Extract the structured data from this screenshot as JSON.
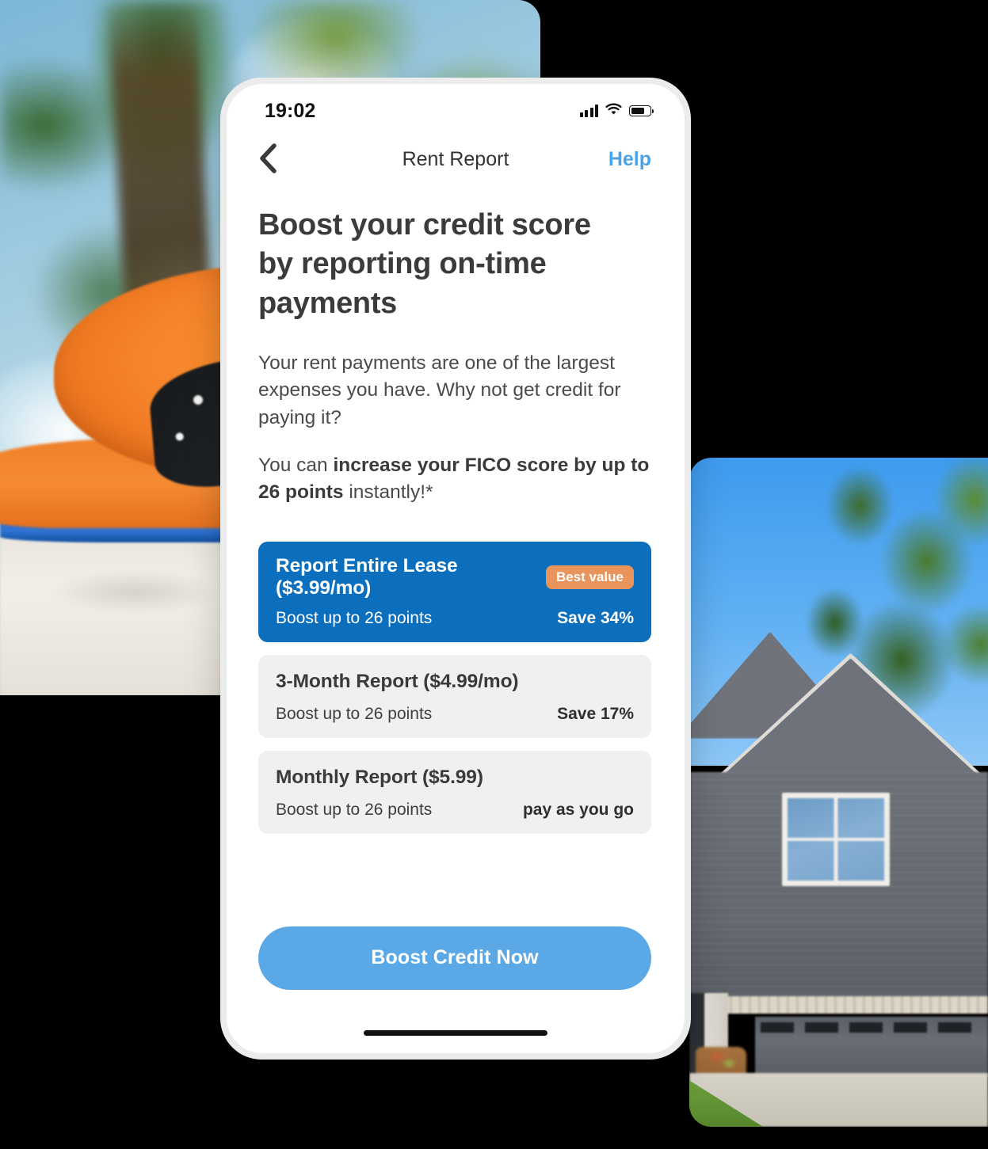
{
  "background": {
    "canvas_color": "#000000",
    "photo_beach": {
      "alt": "Blurred palm tree and sky above an orange sun hat with black polka-dot ribbon on white sand"
    },
    "photo_house": {
      "alt": "Gray two-story house with white-trim window, garage door, concrete driveway and green lawn under blue sky"
    }
  },
  "phone": {
    "status_bar": {
      "time": "19:02",
      "signal_icon": "cellular-signal-icon",
      "wifi_icon": "wifi-icon",
      "battery_icon": "battery-icon",
      "battery_level_percent": 72
    },
    "nav": {
      "back_icon": "chevron-left-icon",
      "title": "Rent Report",
      "help_label": "Help"
    },
    "content": {
      "headline": "Boost your credit score by reporting on-time payments",
      "paragraph_1": "Your rent payments are one of the largest expenses you have. Why not get credit for paying it?",
      "paragraph_2_prefix": "You can ",
      "paragraph_2_bold": "increase your FICO score by up to 26 points",
      "paragraph_2_suffix": " instantly!*"
    },
    "plans": [
      {
        "title": "Report Entire Lease ($3.99/mo)",
        "badge": "Best value",
        "subtitle": "Boost up to 26 points",
        "note": "Save 34%",
        "selected": true
      },
      {
        "title": "3-Month Report ($4.99/mo)",
        "badge": "",
        "subtitle": "Boost up to 26 points",
        "note": "Save 17%",
        "selected": false
      },
      {
        "title": "Monthly Report ($5.99)",
        "badge": "",
        "subtitle": "Boost up to 26 points",
        "note": "pay as you go",
        "selected": false
      }
    ],
    "cta": {
      "label": "Boost Credit Now"
    },
    "home_indicator": "home-indicator"
  },
  "colors": {
    "selected_plan_bg": "#0b6fbe",
    "badge_bg": "#e9945a",
    "cta_bg": "#5aa9e6",
    "help_link": "#4aa3e8",
    "plan_bg": "#f0f0f0",
    "text_primary": "#3b3b3b"
  }
}
